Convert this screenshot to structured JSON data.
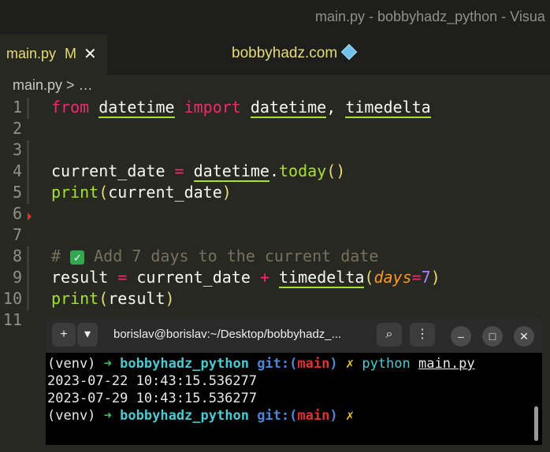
{
  "window": {
    "title": "main.py - bobbyhadz_python - Visua"
  },
  "tabs": {
    "active_label": "main.py",
    "modified": "M",
    "close": "✕",
    "center_title": "bobbyhadz.com"
  },
  "breadcrumb": {
    "file": "main.py",
    "sep": ">",
    "more": "…"
  },
  "editor": {
    "line_numbers": [
      "1",
      "2",
      "3",
      "4",
      "5",
      "6",
      "7",
      "8",
      "9",
      "10",
      "11"
    ],
    "line1": {
      "from": "from",
      "mod": "datetime",
      "import": "import",
      "cls": "datetime",
      "comma": ",",
      "cls2": "timedelta"
    },
    "line4": {
      "var": "current_date",
      "eq": "=",
      "cls": "datetime",
      "dot": ".",
      "method": "today",
      "parens": "()"
    },
    "line5": {
      "fn": "print",
      "open": "(",
      "arg": "current_date",
      "close": ")"
    },
    "line8": {
      "hash": "#",
      "text": " Add 7 days to the current date"
    },
    "line9": {
      "var": "result",
      "eq": "=",
      "base": "current_date",
      "plus": "+",
      "fn": "timedelta",
      "open": "(",
      "kw": "days",
      "assign": "=",
      "num": "7",
      "close": ")"
    },
    "line10": {
      "fn": "print",
      "open": "(",
      "arg": "result",
      "close": ")"
    }
  },
  "terminal": {
    "title": "borislav@borislav:~/Desktop/bobbyhadz_...",
    "new_tab": "+",
    "dropdown": "▾",
    "search": "⌕",
    "menu": "⋮",
    "minimize": "–",
    "maximize": "□",
    "close": "✕",
    "venv": "(venv)",
    "arrow": "➜",
    "dir": "bobbyhadz_python",
    "git": "git:(",
    "branch": "main",
    "git_close": ")",
    "dirty": "✗",
    "cmd": "python",
    "file": "main.py",
    "out1": "2023-07-22 10:43:15.536277",
    "out2": "2023-07-29 10:43:15.536277"
  }
}
